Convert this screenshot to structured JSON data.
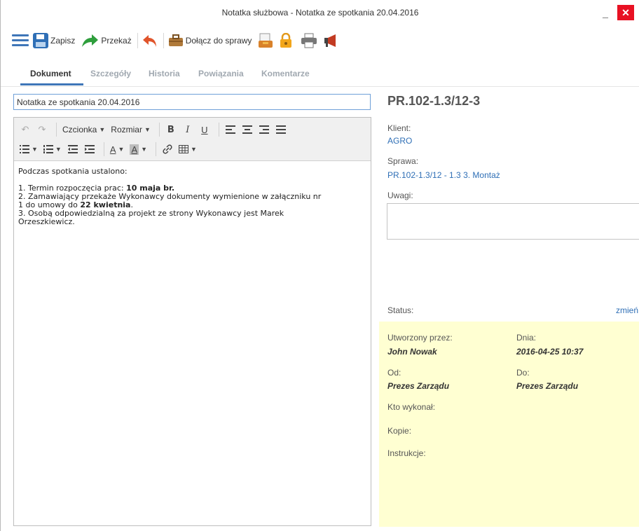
{
  "window": {
    "title": "Notatka służbowa - Notatka ze spotkania 20.04.2016",
    "minimize_label": "_",
    "close_label": "✕"
  },
  "toolbar": {
    "save_label": "Zapisz",
    "forward_label": "Przekaż",
    "attach_label": "Dołącz do sprawy",
    "icons": [
      "menu-icon",
      "save-icon",
      "forward-icon",
      "undo-icon",
      "briefcase-icon",
      "document-icon",
      "lock-icon",
      "printer-icon",
      "megaphone-icon"
    ]
  },
  "tabs": [
    {
      "label": "Dokument",
      "active": true
    },
    {
      "label": "Szczegóły",
      "active": false
    },
    {
      "label": "Historia",
      "active": false
    },
    {
      "label": "Powiązania",
      "active": false
    },
    {
      "label": "Komentarze",
      "active": false
    }
  ],
  "subject": {
    "value": "Notatka ze spotkania 20.04.2016"
  },
  "editor_toolbar": {
    "font_label": "Czcionka",
    "size_label": "Rozmiar",
    "bold": "B",
    "italic": "I",
    "underline": "U",
    "text_color": "A",
    "bg_color": "A"
  },
  "editor_content": {
    "intro": "Podczas spotkania ustalono:",
    "item1_text": "1. Termin rozpoczęcia prac: ",
    "item1_bold": "10 maja br.",
    "item2_line1": "2. Zamawiający przekaże Wykonawcy dokumenty wymienione w załączniku nr",
    "item2_line2_text": "1 do umowy do ",
    "item2_line2_bold": "22 kwietnia",
    "item2_line2_end": ".",
    "item3_line1": "3. Osobą odpowiedzialną za projekt ze strony Wykonawcy jest Marek",
    "item3_line2": "Orzeszkiewicz."
  },
  "details": {
    "doc_number": "PR.102-1.3/12-3",
    "client_label": "Klient:",
    "client_value": "AGRO",
    "case_label": "Sprawa:",
    "case_value": "PR.102-1.3/12 - 1.3 3. Montaż",
    "notes_label": "Uwagi:",
    "notes_value": "",
    "status_label": "Status:",
    "status_change": "zmień"
  },
  "info_panel": {
    "created_by_label": "Utworzony przez:",
    "created_by_value": "John Nowak",
    "date_label": "Dnia:",
    "date_value": "2016-04-25 10:37",
    "from_label": "Od:",
    "from_value": "Prezes Zarządu",
    "to_label": "Do:",
    "to_value": "Prezes Zarządu",
    "executed_by_label": "Kto wykonał:",
    "copies_label": "Kopie:",
    "instructions_label": "Instrukcje:"
  },
  "colors": {
    "accent": "#3f76b8",
    "link": "#2f6fb6",
    "panel_bg": "#ffffd2",
    "close_red": "#e81123"
  }
}
